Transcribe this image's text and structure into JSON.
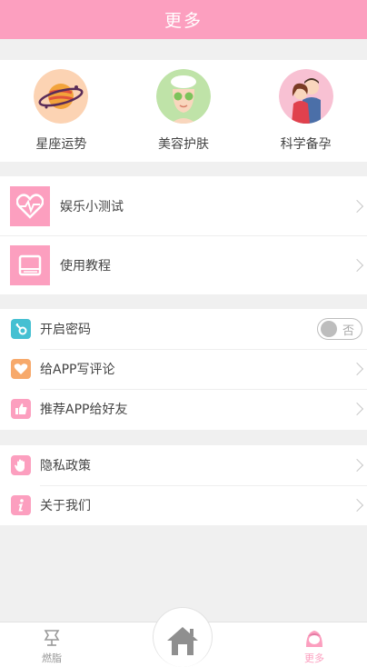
{
  "header": {
    "title": "更多"
  },
  "features": [
    {
      "label": "星座运势",
      "icon": "planet-icon"
    },
    {
      "label": "美容护肤",
      "icon": "skincare-face-icon"
    },
    {
      "label": "科学备孕",
      "icon": "couple-icon"
    }
  ],
  "group1": [
    {
      "label": "娱乐小测试",
      "icon": "heartbeat-icon"
    },
    {
      "label": "使用教程",
      "icon": "book-icon"
    }
  ],
  "group2": [
    {
      "label": "开启密码",
      "icon": "key-icon",
      "toggle": "否"
    },
    {
      "label": "给APP写评论",
      "icon": "heart-comment-icon"
    },
    {
      "label": "推荐APP给好友",
      "icon": "thumbs-up-icon"
    }
  ],
  "group3": [
    {
      "label": "隐私政策",
      "icon": "hand-icon"
    },
    {
      "label": "关于我们",
      "icon": "info-icon"
    }
  ],
  "tabbar": {
    "left": {
      "label": "燃脂",
      "icon": "dumbbell-icon"
    },
    "center": {
      "icon": "home-icon"
    },
    "right": {
      "label": "更多",
      "icon": "girl-avatar-icon"
    }
  },
  "colors": {
    "accent": "#fc9fbf",
    "teal": "#45c0d2",
    "orange": "#f7a96b",
    "inactive": "#999999"
  }
}
